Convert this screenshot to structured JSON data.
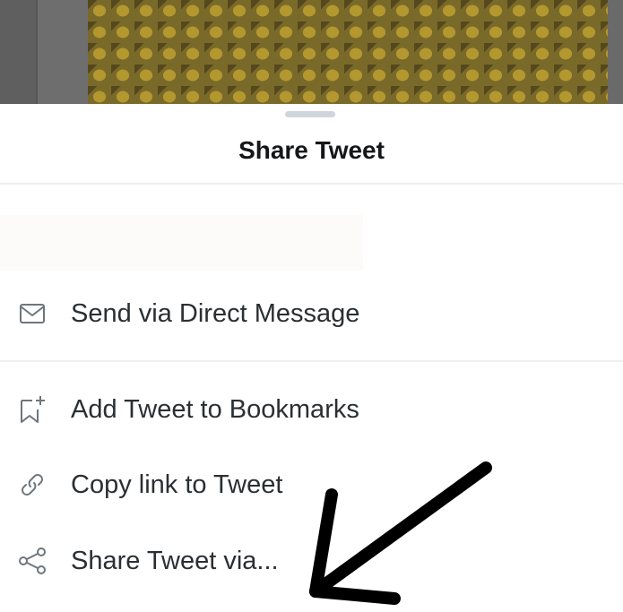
{
  "sheet": {
    "title": "Share Tweet",
    "items": [
      {
        "label": "Send via Direct Message",
        "icon": "envelope-icon"
      },
      {
        "label": "Add Tweet to Bookmarks",
        "icon": "bookmark-add-icon"
      },
      {
        "label": "Copy link to Tweet",
        "icon": "link-icon"
      },
      {
        "label": "Share Tweet via...",
        "icon": "share-icon"
      }
    ]
  },
  "colors": {
    "text": "#2a2f33",
    "icon": "#6e767d",
    "backdrop": "#6e6e6e",
    "annotation_arrow": "#000000"
  }
}
